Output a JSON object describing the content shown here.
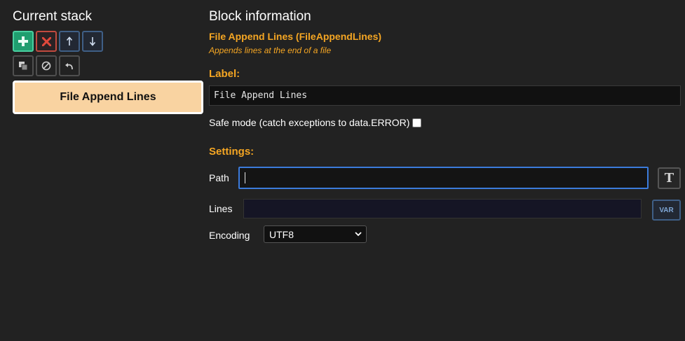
{
  "stack": {
    "title": "Current stack",
    "toolbar": {
      "row1": [
        {
          "name": "add-block-button",
          "icon": "plus-icon",
          "color": "#1f9e6f"
        },
        {
          "name": "remove-block-button",
          "icon": "close-icon",
          "color": "#c24a3f"
        },
        {
          "name": "move-up-button",
          "icon": "arrow-up-icon",
          "color": "#3f5f86"
        },
        {
          "name": "move-down-button",
          "icon": "arrow-down-icon",
          "color": "#3f5f86"
        }
      ],
      "row2": [
        {
          "name": "duplicate-button",
          "icon": "copy-icon"
        },
        {
          "name": "disable-button",
          "icon": "disable-icon"
        },
        {
          "name": "undo-button",
          "icon": "undo-icon"
        }
      ]
    },
    "items": [
      {
        "label": "File Append Lines",
        "color": "#f9d3a1"
      }
    ]
  },
  "info": {
    "title": "Block information",
    "block_name": "File Append Lines (FileAppendLines)",
    "block_description": "Appends lines at the end of a file",
    "label_heading": "Label:",
    "label_value": "File Append Lines",
    "safe_mode_label": "Safe mode (catch exceptions to data.ERROR)",
    "safe_mode_checked": false,
    "settings_heading": "Settings:",
    "accent_color": "#f5a623"
  },
  "settings": {
    "path": {
      "label": "Path",
      "value": "",
      "type_button_icon": "text-type-icon",
      "type_button_label": "T"
    },
    "lines": {
      "label": "Lines",
      "value": "",
      "var_button_label": "VAR"
    },
    "encoding": {
      "label": "Encoding",
      "selected": "UTF8"
    }
  }
}
